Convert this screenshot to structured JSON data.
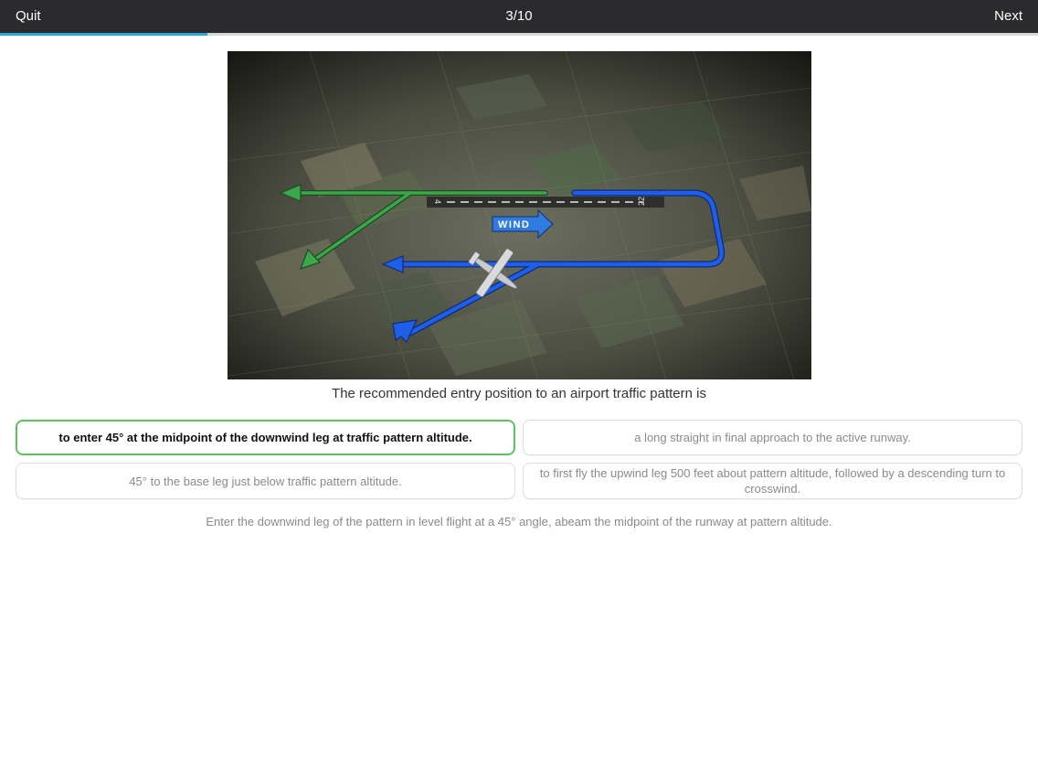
{
  "topbar": {
    "quit_label": "Quit",
    "counter": "3/10",
    "next_label": "Next",
    "progress_fraction": 0.2
  },
  "illustration": {
    "runway_left_number": "4",
    "runway_right_number": "22",
    "wind_label": "WIND",
    "colors": {
      "departure_path": "#3aa84a",
      "entry_path": "#1f5ee8",
      "ground": "#5b5e50"
    }
  },
  "question": {
    "text": "The recommended entry position to an airport traffic pattern is"
  },
  "answers": [
    {
      "text": "to enter 45° at the midpoint of the downwind leg at traffic pattern altitude.",
      "state": "correct"
    },
    {
      "text": "a long straight in final approach to the active runway.",
      "state": "normal"
    },
    {
      "text": "45° to the base leg just below traffic pattern altitude.",
      "state": "normal"
    },
    {
      "text": "to first fly the upwind leg 500 feet about pattern altitude, followed by a descending turn to crosswind.",
      "state": "normal"
    }
  ],
  "explanation": {
    "text": "Enter the downwind leg of the pattern in level flight at a 45° angle, abeam the midpoint of the runway at pattern altitude."
  },
  "colors": {
    "correct_border": "#5cc45c",
    "progress_fill": "#2aa7d8",
    "topbar_bg": "#2b2b2d"
  }
}
